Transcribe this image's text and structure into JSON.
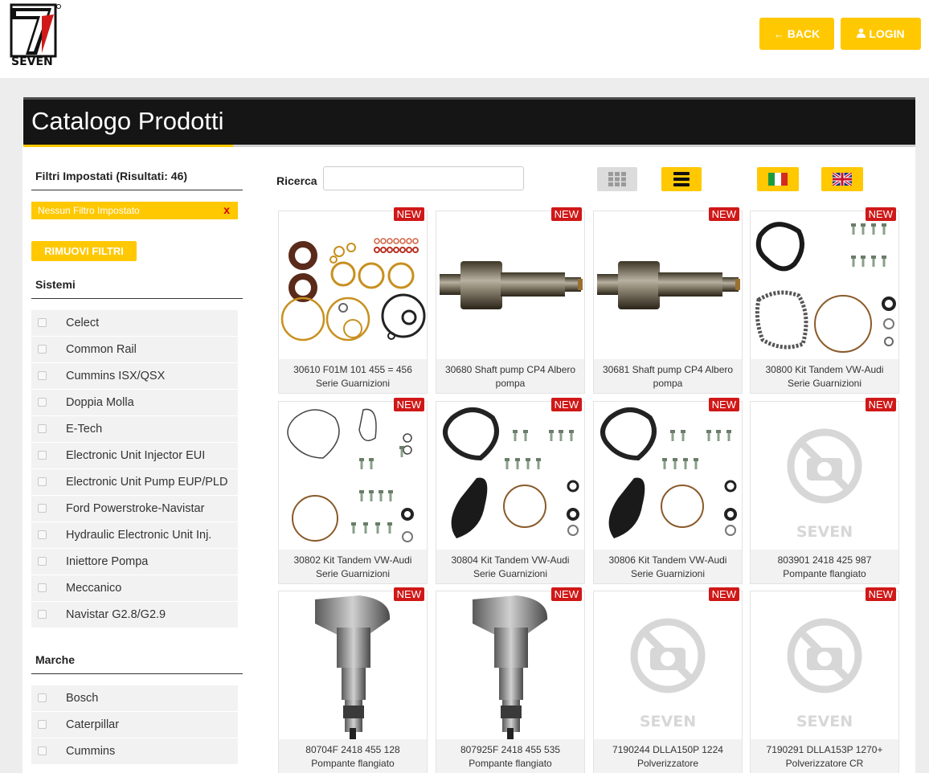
{
  "header": {
    "logo_text": "SEVEN",
    "back_label": "BACK",
    "login_label": "LOGIN",
    "back_icon": "arrow-left-icon",
    "login_icon": "user-icon"
  },
  "page_title": "Catalogo Prodotti",
  "sidebar": {
    "filters_title": "Filtri Impostati (Risultati: 46)",
    "no_filter_chip": "Nessun Filtro Impostato",
    "chip_remove": "x",
    "remove_filters_button": "RIMUOVI FILTRI",
    "systems_title": "Sistemi",
    "systems": [
      "Celect",
      "Common Rail",
      "Cummins ISX/QSX",
      "Doppia Molla",
      "E-Tech",
      "Electronic Unit Injector EUI",
      "Electronic Unit Pump EUP/PLD",
      "Ford Powerstroke-Navistar",
      "Hydraulic Electronic Unit Inj.",
      "Iniettore Pompa",
      "Meccanico",
      "Navistar G2.8/G2.9"
    ],
    "brands_title": "Marche",
    "brands": [
      "Bosch",
      "Caterpillar",
      "Cummins"
    ]
  },
  "toolbar": {
    "search_label": "Ricerca",
    "search_value": "",
    "grid_view_icon": "grid-view-icon",
    "list_view_icon": "list-view-icon",
    "lang_it_icon": "flag-italy-icon",
    "lang_en_icon": "flag-uk-icon"
  },
  "colors": {
    "accent": "#ffc800",
    "badge": "#d01818",
    "header_bg": "#151515"
  },
  "products": [
    {
      "line1": "30610 F01M 101 455 = 456",
      "line2": "Serie Guarnizioni",
      "badge": "NEW",
      "image": "gasket-set"
    },
    {
      "line1": "30680 Shaft pump CP4 Albero",
      "line2": "pompa",
      "badge": "NEW",
      "image": "shaft"
    },
    {
      "line1": "30681 Shaft pump CP4 Albero",
      "line2": "pompa",
      "badge": "NEW",
      "image": "shaft"
    },
    {
      "line1": "30800 Kit Tandem VW-Audi",
      "line2": "Serie Guarnizioni",
      "badge": "NEW",
      "image": "tandem-kit"
    },
    {
      "line1": "30802 Kit Tandem VW-Audi",
      "line2": "Serie Guarnizioni",
      "badge": "NEW",
      "image": "tandem-kit-2"
    },
    {
      "line1": "30804 Kit Tandem VW-Audi",
      "line2": "Serie Guarnizioni",
      "badge": "NEW",
      "image": "tandem-kit-3"
    },
    {
      "line1": "30806 Kit Tandem VW-Audi",
      "line2": "Serie Guarnizioni",
      "badge": "NEW",
      "image": "tandem-kit-3"
    },
    {
      "line1": "803901 2418 425 987",
      "line2": "Pompante flangiato",
      "badge": "NEW",
      "image": "placeholder"
    },
    {
      "line1": "80704F 2418 455 128",
      "line2": "Pompante flangiato",
      "badge": "NEW",
      "image": "plunger"
    },
    {
      "line1": "807925F 2418 455 535",
      "line2": "Pompante flangiato",
      "badge": "NEW",
      "image": "plunger"
    },
    {
      "line1": "7190244 DLLA150P 1224",
      "line2": "Polverizzatore",
      "badge": "NEW",
      "image": "placeholder"
    },
    {
      "line1": "7190291 DLLA153P 1270+",
      "line2": "Polverizzatore CR",
      "badge": "NEW",
      "image": "placeholder"
    }
  ],
  "placeholder_logo_text": "SEVEN"
}
